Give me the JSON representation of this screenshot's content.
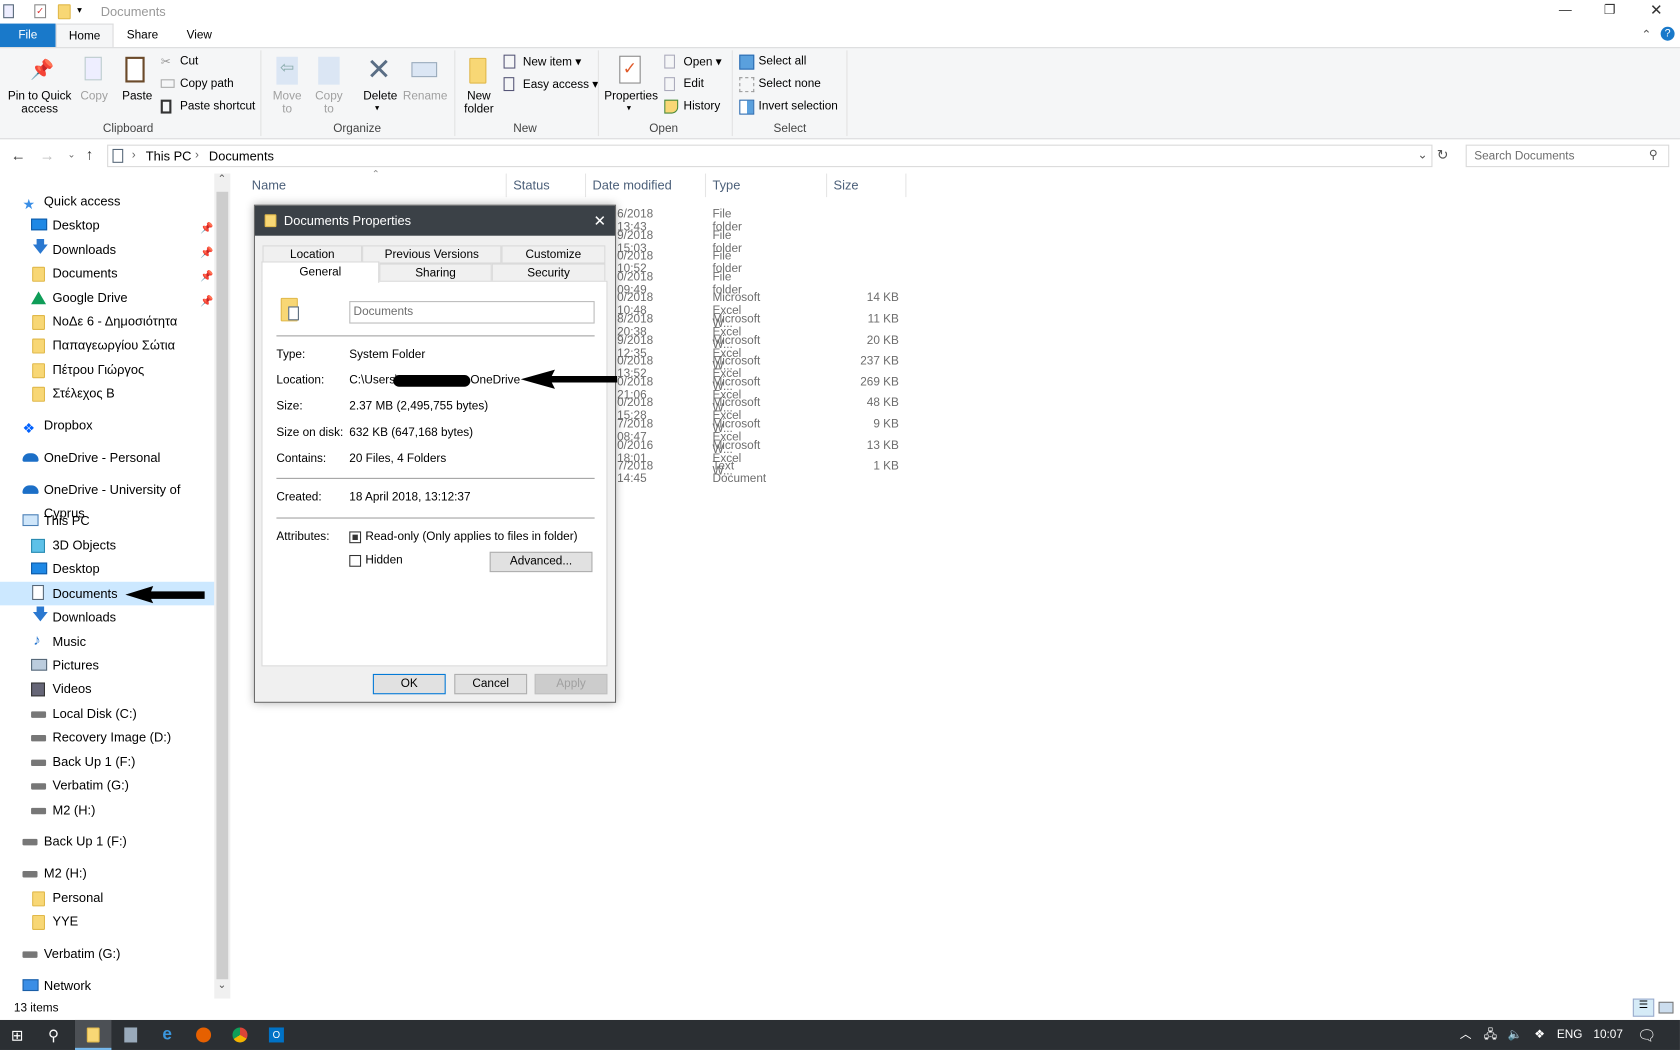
{
  "window": {
    "title": "Documents"
  },
  "ribbon_tabs": [
    "File",
    "Home",
    "Share",
    "View"
  ],
  "ribbon": {
    "clipboard": {
      "label": "Clipboard",
      "pin": "Pin to Quick access",
      "copy": "Copy",
      "paste": "Paste",
      "cut": "Cut",
      "copy_path": "Copy path",
      "paste_shortcut": "Paste shortcut"
    },
    "organize": {
      "label": "Organize",
      "move_to": "Move to",
      "copy_to": "Copy to",
      "delete": "Delete",
      "rename": "Rename"
    },
    "new": {
      "label": "New",
      "new_folder": "New folder",
      "new_item": "New item",
      "easy_access": "Easy access"
    },
    "open": {
      "label": "Open",
      "properties": "Properties",
      "open": "Open",
      "edit": "Edit",
      "history": "History"
    },
    "select": {
      "label": "Select",
      "select_all": "Select all",
      "select_none": "Select none",
      "invert": "Invert selection"
    }
  },
  "address": {
    "crumbs": [
      "This PC",
      "Documents"
    ],
    "search_placeholder": "Search Documents"
  },
  "columns": [
    "Name",
    "Status",
    "Date modified",
    "Type",
    "Size"
  ],
  "rows": [
    {
      "date": "6/2018 13:43",
      "type": "File folder",
      "size": ""
    },
    {
      "date": "9/2018 15:03",
      "type": "File folder",
      "size": ""
    },
    {
      "date": "0/2018 10:52",
      "type": "File folder",
      "size": ""
    },
    {
      "date": "0/2018 09:49",
      "type": "File folder",
      "size": ""
    },
    {
      "date": "0/2018 10:48",
      "type": "Microsoft Excel W...",
      "size": "14 KB"
    },
    {
      "date": "8/2018 20:38",
      "type": "Microsoft Excel W...",
      "size": "11 KB"
    },
    {
      "date": "9/2018 12:35",
      "type": "Microsoft Excel W...",
      "size": "20 KB"
    },
    {
      "date": "0/2018 13:52",
      "type": "Microsoft Excel W...",
      "size": "237 KB"
    },
    {
      "date": "0/2018 21:06",
      "type": "Microsoft Excel W...",
      "size": "269 KB"
    },
    {
      "date": "0/2018 15:28",
      "type": "Microsoft Excel W...",
      "size": "48 KB"
    },
    {
      "date": "7/2018 08:47",
      "type": "Microsoft Excel W...",
      "size": "9 KB"
    },
    {
      "date": "0/2016 18:01",
      "type": "Microsoft Excel W...",
      "size": "13 KB"
    },
    {
      "date": "7/2018 14:45",
      "type": "Text Document",
      "size": "1 KB"
    }
  ],
  "sidebar": [
    {
      "label": "Quick access",
      "icon": "star-icon",
      "level": 0
    },
    {
      "label": "Desktop",
      "icon": "desktop-icon",
      "level": 1,
      "pinned": true
    },
    {
      "label": "Downloads",
      "icon": "download-icon",
      "level": 1,
      "pinned": true
    },
    {
      "label": "Documents",
      "icon": "folder-icon",
      "level": 1,
      "pinned": true
    },
    {
      "label": "Google Drive",
      "icon": "google-drive-icon",
      "level": 1,
      "pinned": true
    },
    {
      "label": "ΝοΔε 6 - Δημοσιότητα",
      "icon": "folder-icon",
      "level": 1
    },
    {
      "label": "Παπαγεωργίου Σώτια",
      "icon": "folder-icon",
      "level": 1
    },
    {
      "label": "Πέτρου Γιώργος",
      "icon": "folder-icon",
      "level": 1
    },
    {
      "label": "Στέλεχος Β",
      "icon": "folder-icon",
      "level": 1
    },
    {
      "label": "Dropbox",
      "icon": "dropbox-icon",
      "level": 0
    },
    {
      "label": "OneDrive - Personal",
      "icon": "cloud-icon",
      "level": 0
    },
    {
      "label": "OneDrive - University of Cyprus",
      "icon": "cloud-icon",
      "level": 0
    },
    {
      "label": "This PC",
      "icon": "computer-icon",
      "level": 0
    },
    {
      "label": "3D Objects",
      "icon": "cube-icon",
      "level": 1
    },
    {
      "label": "Desktop",
      "icon": "desktop-icon",
      "level": 1
    },
    {
      "label": "Documents",
      "icon": "document-icon",
      "level": 1,
      "selected": true
    },
    {
      "label": "Downloads",
      "icon": "download-icon",
      "level": 1
    },
    {
      "label": "Music",
      "icon": "music-icon",
      "level": 1
    },
    {
      "label": "Pictures",
      "icon": "pictures-icon",
      "level": 1
    },
    {
      "label": "Videos",
      "icon": "video-icon",
      "level": 1
    },
    {
      "label": "Local Disk (C:)",
      "icon": "drive-icon",
      "level": 1
    },
    {
      "label": "Recovery Image (D:)",
      "icon": "drive-icon",
      "level": 1
    },
    {
      "label": "Back Up 1 (F:)",
      "icon": "drive-icon",
      "level": 1
    },
    {
      "label": "Verbatim (G:)",
      "icon": "drive-icon",
      "level": 1
    },
    {
      "label": "M2 (H:)",
      "icon": "drive-icon",
      "level": 1
    },
    {
      "label": "Back Up 1 (F:)",
      "icon": "drive-icon",
      "level": 0
    },
    {
      "label": "M2 (H:)",
      "icon": "drive-icon",
      "level": 0
    },
    {
      "label": "Personal",
      "icon": "folder-icon",
      "level": 1
    },
    {
      "label": "YYE",
      "icon": "folder-icon",
      "level": 1
    },
    {
      "label": "Verbatim (G:)",
      "icon": "drive-icon",
      "level": 0
    },
    {
      "label": "Network",
      "icon": "network-icon",
      "level": 0
    }
  ],
  "status": {
    "items": "13 items"
  },
  "dialog": {
    "title": "Documents Properties",
    "tabs_back": [
      "Location",
      "Previous Versions",
      "Customize"
    ],
    "tabs_front": [
      "General",
      "Sharing",
      "Security"
    ],
    "name": "Documents",
    "fields": [
      {
        "label": "Type:",
        "value": "System Folder"
      },
      {
        "label": "Location:",
        "value": "C:\\Users\\",
        "value2": "OneDrive"
      },
      {
        "label": "Size:",
        "value": "2.37 MB (2,495,755 bytes)"
      },
      {
        "label": "Size on disk:",
        "value": "632 KB (647,168 bytes)"
      },
      {
        "label": "Contains:",
        "value": "20 Files, 4 Folders"
      }
    ],
    "created_label": "Created:",
    "created": "18 April 2018, 13:12:37",
    "attributes_label": "Attributes:",
    "readonly": "Read-only (Only applies to files in folder)",
    "readonly_state": "indeterminate",
    "hidden": "Hidden",
    "hidden_checked": false,
    "advanced": "Advanced...",
    "ok": "OK",
    "cancel": "Cancel",
    "apply": "Apply"
  },
  "taskbar": {
    "lang": "ENG",
    "time": "10:07"
  },
  "colors": {
    "file_tab": "#1979ca",
    "selection": "#cce8ff",
    "taskbar": "#2b2f33",
    "dialog_title": "#3b4147"
  }
}
